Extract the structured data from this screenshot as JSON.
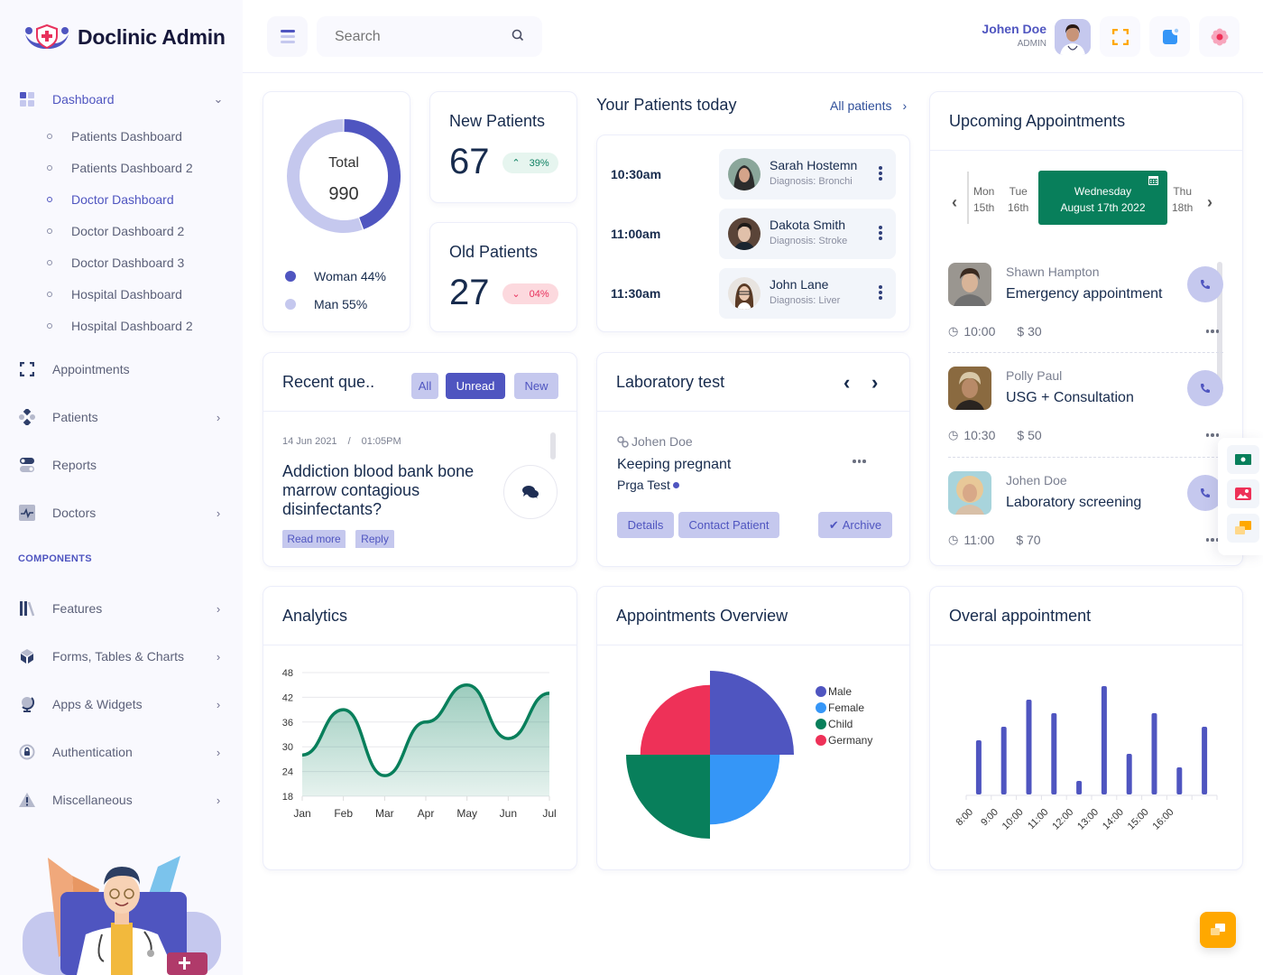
{
  "app": {
    "title": "Doclinic Admin"
  },
  "sidebar": {
    "dashboard": {
      "label": "Dashboard",
      "icon": "grid-icon",
      "expanded": true
    },
    "subitems": [
      {
        "label": "Patients Dashboard",
        "active": false
      },
      {
        "label": "Patients Dashboard 2",
        "active": false
      },
      {
        "label": "Doctor Dashboard",
        "active": true
      },
      {
        "label": "Doctor Dashboard 2",
        "active": false
      },
      {
        "label": "Doctor Dashboard 3",
        "active": false
      },
      {
        "label": "Hospital Dashboard",
        "active": false
      },
      {
        "label": "Hospital Dashboard 2",
        "active": false
      }
    ],
    "items": [
      {
        "label": "Appointments",
        "icon": "scan-icon",
        "has_children": false
      },
      {
        "label": "Patients",
        "icon": "nodes-icon",
        "has_children": true
      },
      {
        "label": "Reports",
        "icon": "toggle-icon",
        "has_children": false
      },
      {
        "label": "Doctors",
        "icon": "pulse-icon",
        "has_children": true
      }
    ],
    "section_label": "COMPONENTS",
    "component_items": [
      {
        "label": "Features",
        "icon": "library-icon"
      },
      {
        "label": "Forms, Tables & Charts",
        "icon": "box-icon"
      },
      {
        "label": "Apps & Widgets",
        "icon": "globe-icon"
      },
      {
        "label": "Authentication",
        "icon": "lock-icon"
      },
      {
        "label": "Miscellaneous",
        "icon": "warning-icon"
      }
    ]
  },
  "topbar": {
    "search_placeholder": "Search",
    "user_name": "Johen Doe",
    "user_role": "ADMIN"
  },
  "total_card": {
    "label": "Total",
    "value": "990",
    "legend": [
      {
        "label": "Woman 44%",
        "color": "#4f55c0"
      },
      {
        "label": "Man 55%",
        "color": "#c5c8ee"
      }
    ]
  },
  "new_patients": {
    "title": "New Patients",
    "value": "67",
    "change": "39%",
    "direction": "up"
  },
  "old_patients": {
    "title": "Old Patients",
    "value": "27",
    "change": "04%",
    "direction": "down"
  },
  "patients_today": {
    "title": "Your Patients today",
    "link": "All patients",
    "rows": [
      {
        "time": "10:30am",
        "name": "Sarah Hostemn",
        "diagnosis": "Diagnosis: Bronchi"
      },
      {
        "time": "11:00am",
        "name": "Dakota Smith",
        "diagnosis": "Diagnosis: Stroke"
      },
      {
        "time": "11:30am",
        "name": "John Lane",
        "diagnosis": "Diagnosis: Liver"
      }
    ]
  },
  "upcoming": {
    "title": "Upcoming Appointments",
    "days": [
      {
        "day": "Mon",
        "date": "15th"
      },
      {
        "day": "Tue",
        "date": "16th"
      },
      {
        "day": "Wednesday",
        "date": "August 17th 2022",
        "selected": true
      },
      {
        "day": "Thu",
        "date": "18th"
      }
    ],
    "appointments": [
      {
        "name": "Shawn Hampton",
        "title": "Emergency appointment",
        "time": "10:00",
        "price": "$ 30"
      },
      {
        "name": "Polly Paul",
        "title": "USG + Consultation",
        "time": "10:30",
        "price": "$ 50"
      },
      {
        "name": "Johen Doe",
        "title": "Laboratory screening",
        "time": "11:00",
        "price": "$ 70"
      }
    ]
  },
  "recent_questions": {
    "title": "Recent que..",
    "filters": [
      {
        "label": "All",
        "active": false
      },
      {
        "label": "Unread",
        "active": true
      },
      {
        "label": "New",
        "active": false
      }
    ],
    "date": "14 Jun 2021",
    "separator": "/",
    "time": "01:05PM",
    "question": "Addiction blood bank bone marrow contagious disinfectants?",
    "read_more": "Read more",
    "reply": "Reply"
  },
  "lab_test": {
    "title": "Laboratory test",
    "patient": "Johen Doe",
    "test_title": "Keeping pregnant",
    "test_name": "Prga Test",
    "buttons": {
      "details": "Details",
      "contact": "Contact Patient",
      "archive": "Archive"
    }
  },
  "colors": {
    "primary": "#4f55c0",
    "primary_soft": "#c5c8ee",
    "green": "#087f5b",
    "blue": "#3596f7",
    "red": "#ee3158",
    "orange": "#ffa800"
  },
  "chart_data": [
    {
      "type": "line",
      "title": "Analytics",
      "categories": [
        "Jan",
        "Feb",
        "Mar",
        "Apr",
        "May",
        "Jun",
        "Jul"
      ],
      "series": [
        {
          "name": "Analytics",
          "values": [
            28,
            39,
            23,
            36,
            45,
            32,
            43
          ]
        }
      ],
      "ylim": [
        18,
        48
      ],
      "yticks": [
        18,
        24,
        30,
        36,
        42,
        48
      ],
      "area": true,
      "grid": true,
      "color": "#087f5b"
    },
    {
      "type": "polar-area",
      "title": "Appointments Overview",
      "categories": [
        "Male",
        "Female",
        "Child",
        "Germany"
      ],
      "values": [
        12,
        10,
        12,
        10
      ],
      "colors": [
        "#4f55c0",
        "#3596f7",
        "#087f5b",
        "#ee3158"
      ],
      "legend": "right"
    },
    {
      "type": "bar",
      "title": "Overal appointment",
      "categories": [
        "8:00",
        "9:00",
        "10:00",
        "11:00",
        "12:00",
        "13:00",
        "14:00",
        "15:00",
        "16:00",
        ""
      ],
      "values": [
        40,
        50,
        70,
        60,
        10,
        80,
        30,
        60,
        20,
        50
      ],
      "ylim": [
        0,
        80
      ],
      "color": "#4f55c0"
    },
    {
      "type": "pie",
      "title": "Total",
      "categories": [
        "Woman",
        "Man"
      ],
      "values": [
        44,
        55
      ],
      "colors": [
        "#4f55c0",
        "#c5c8ee"
      ]
    }
  ]
}
